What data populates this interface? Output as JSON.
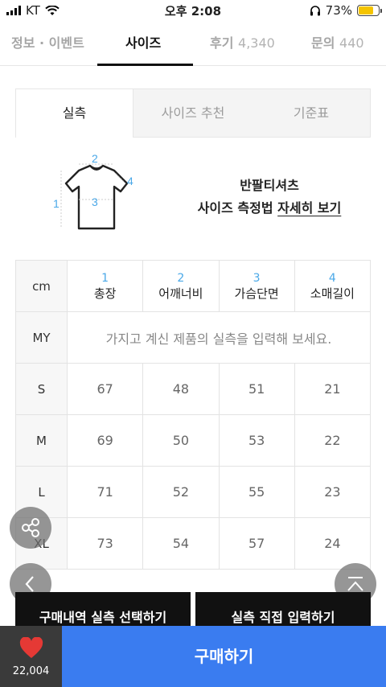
{
  "status": {
    "carrier": "KT",
    "time": "오후 2:08",
    "battery": "73%",
    "battery_level": 0.73
  },
  "tabs": [
    {
      "label": "정보 · 이벤트",
      "count": ""
    },
    {
      "label": "사이즈",
      "count": ""
    },
    {
      "label": "후기",
      "count": "4,340"
    },
    {
      "label": "문의",
      "count": "440"
    }
  ],
  "subtabs": [
    "실측",
    "사이즈 추천",
    "기준표"
  ],
  "guide": {
    "title": "반팔티셔츠",
    "line2_prefix": "사이즈 측정법",
    "link": "자세히 보기",
    "markers": [
      "1",
      "2",
      "3",
      "4"
    ]
  },
  "size_table": {
    "unit": "cm",
    "columns": [
      {
        "num": "1",
        "label": "총장"
      },
      {
        "num": "2",
        "label": "어깨너비"
      },
      {
        "num": "3",
        "label": "가슴단면"
      },
      {
        "num": "4",
        "label": "소매길이"
      }
    ],
    "my_label": "MY",
    "my_message": "가지고 계신 제품의 실측을 입력해 보세요.",
    "rows": [
      {
        "size": "S",
        "values": [
          "67",
          "48",
          "51",
          "21"
        ]
      },
      {
        "size": "M",
        "values": [
          "69",
          "50",
          "53",
          "22"
        ]
      },
      {
        "size": "L",
        "values": [
          "71",
          "52",
          "55",
          "23"
        ]
      },
      {
        "size": "XL",
        "values": [
          "73",
          "54",
          "57",
          "24"
        ]
      }
    ]
  },
  "actions": {
    "history": "구매내역 실측 선택하기",
    "direct": "실측 직접 입력하기"
  },
  "buybar": {
    "likes": "22,004",
    "buy": "구매하기",
    "heart_color": "#e53935",
    "accent": "#3a7cf0"
  }
}
